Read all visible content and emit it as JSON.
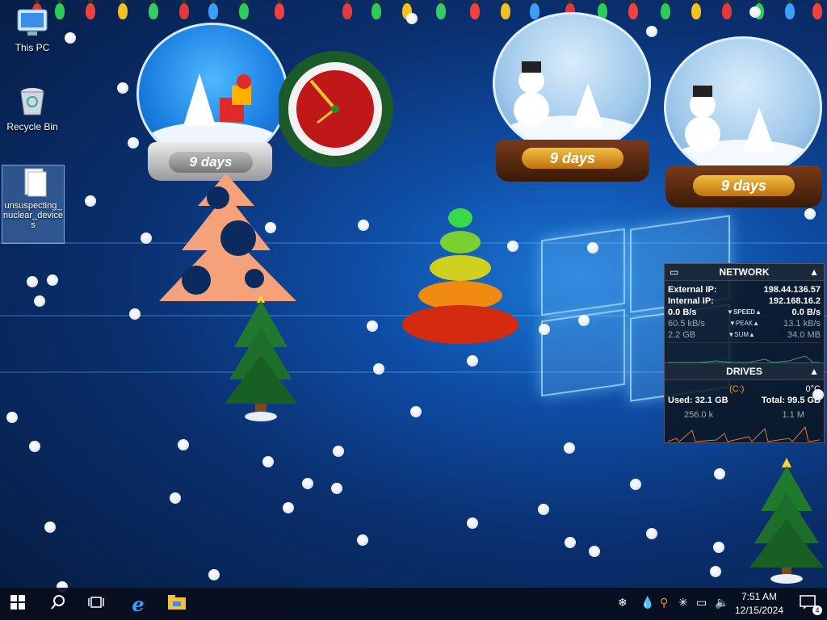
{
  "desktop": {
    "icons": [
      {
        "label": "This PC",
        "icon": "monitor-icon"
      },
      {
        "label": "Recycle Bin",
        "icon": "recycle-bin-icon"
      },
      {
        "label": "unsuspecting_nuclear_devices",
        "icon": "file-icon"
      }
    ]
  },
  "globes": {
    "left_countdown": "9 days",
    "mid_countdown": "9 days",
    "right_countdown": "9 days"
  },
  "network": {
    "title": "NETWORK",
    "external_ip_label": "External IP:",
    "external_ip": "198.44.136.57",
    "internal_ip_label": "Internal IP:",
    "internal_ip": "192.168.16.2",
    "speed_left": "0.0 B/s",
    "speed_label": "SPEED",
    "speed_right": "0.0 B/s",
    "peak_left": "60.5 kB/s",
    "peak_label": "PEAK",
    "peak_right": "13.1 kB/s",
    "sum_left": "2.2 GB",
    "sum_label": "SUM",
    "sum_right": "34.0 MB"
  },
  "drives": {
    "title": "DRIVES",
    "drive_letter": "(C:)",
    "temp": "0°C",
    "used": "Used: 32.1 GB",
    "total": "Total: 99.5 GB",
    "read": "256.0 k",
    "write": "1.1 M"
  },
  "taskbar": {
    "start_icon": "windows-start-icon",
    "search_icon": "search-icon",
    "task_view_icon": "task-view-icon",
    "ie_icon": "internet-explorer-icon",
    "explorer_icon": "file-explorer-icon",
    "time": "7:51 AM",
    "date": "12/15/2024",
    "notifications_count": "4"
  },
  "colors": {
    "accent": "#1b78d6",
    "taskbar": "#080e1c"
  }
}
